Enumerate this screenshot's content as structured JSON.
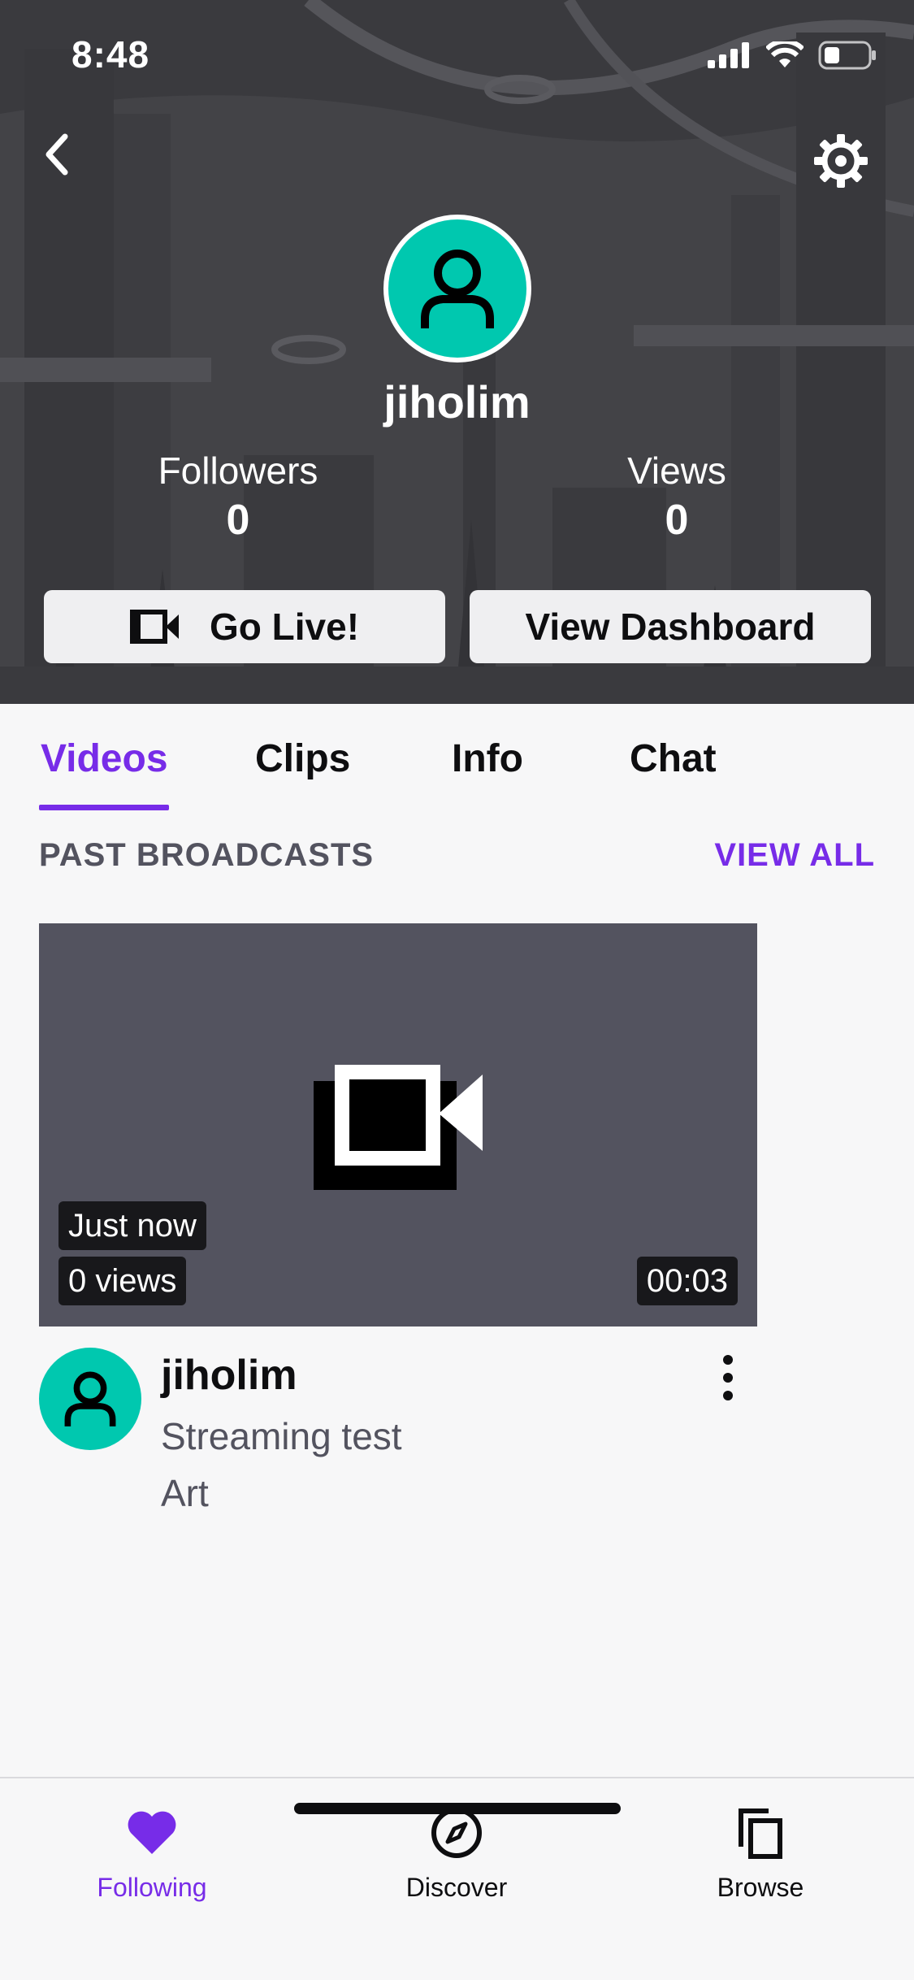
{
  "status_bar": {
    "time": "8:48",
    "battery_level": 0.3
  },
  "header": {
    "back_icon": "chevron-left-icon",
    "settings_icon": "gear-icon",
    "username": "jiholim",
    "followers_label": "Followers",
    "followers_count": "0",
    "views_label": "Views",
    "views_count": "0",
    "go_live_label": "Go Live!",
    "dashboard_label": "View Dashboard"
  },
  "tabs": [
    {
      "label": "Videos",
      "active": true
    },
    {
      "label": "Clips",
      "active": false
    },
    {
      "label": "Info",
      "active": false
    },
    {
      "label": "Chat",
      "active": false
    }
  ],
  "section": {
    "title": "PAST BROADCASTS",
    "view_all": "VIEW ALL"
  },
  "video": {
    "time_badge": "Just now",
    "views_badge": "0 views",
    "duration": "00:03",
    "channel": "jiholim",
    "title": "Streaming test",
    "category": "Art"
  },
  "bottom_nav": [
    {
      "label": "Following",
      "icon": "heart-icon",
      "active": true
    },
    {
      "label": "Discover",
      "icon": "compass-icon",
      "active": false
    },
    {
      "label": "Browse",
      "icon": "copy-icon",
      "active": false
    }
  ],
  "colors": {
    "accent": "#772ce8",
    "avatar": "#00c8af",
    "thumb_bg": "#53535f"
  }
}
